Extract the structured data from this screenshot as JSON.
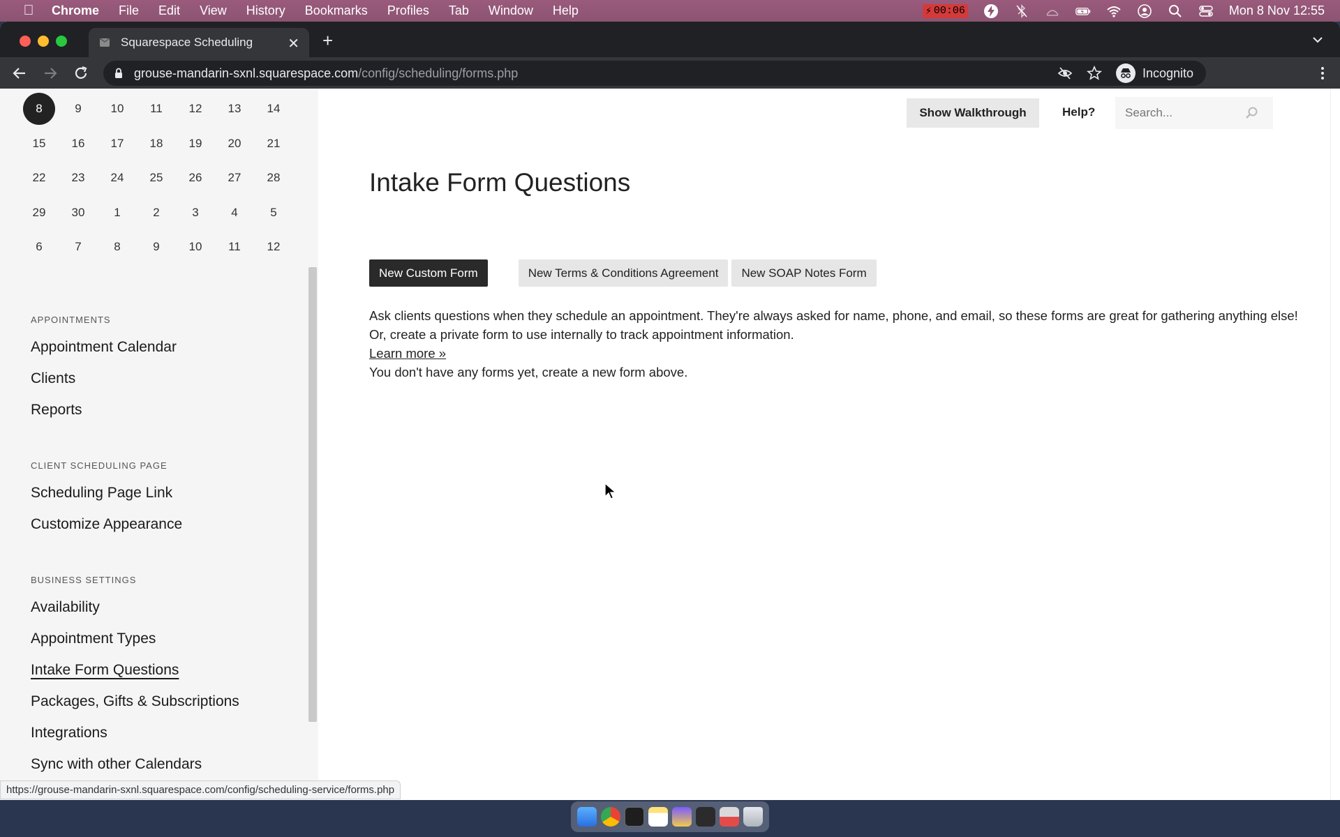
{
  "menubar": {
    "app": "Chrome",
    "items": [
      "File",
      "Edit",
      "View",
      "History",
      "Bookmarks",
      "Profiles",
      "Tab",
      "Window",
      "Help"
    ],
    "recording_time": "00:06",
    "clock": "Mon 8 Nov  12:55"
  },
  "browser": {
    "tab_title": "Squarespace Scheduling",
    "url_host": "grouse-mandarin-sxnl.squarespace.com",
    "url_path": "/config/scheduling/forms.php",
    "profile_label": "Incognito",
    "status_url": "https://grouse-mandarin-sxnl.squarespace.com/config/scheduling-service/forms.php"
  },
  "calendar": {
    "weeks": [
      [
        "8",
        "9",
        "10",
        "11",
        "12",
        "13",
        "14"
      ],
      [
        "15",
        "16",
        "17",
        "18",
        "19",
        "20",
        "21"
      ],
      [
        "22",
        "23",
        "24",
        "25",
        "26",
        "27",
        "28"
      ],
      [
        "29",
        "30",
        "1",
        "2",
        "3",
        "4",
        "5"
      ],
      [
        "6",
        "7",
        "8",
        "9",
        "10",
        "11",
        "12"
      ]
    ]
  },
  "sidebar": {
    "appointments_heading": "APPOINTMENTS",
    "appointments": [
      "Appointment Calendar",
      "Clients",
      "Reports"
    ],
    "client_page_heading": "CLIENT SCHEDULING PAGE",
    "client_page": [
      "Scheduling Page Link",
      "Customize Appearance"
    ],
    "business_heading": "BUSINESS SETTINGS",
    "business": [
      "Availability",
      "Appointment Types",
      "Intake Form Questions",
      "Packages, Gifts & Subscriptions",
      "Integrations",
      "Sync with other Calendars"
    ]
  },
  "main": {
    "walkthrough_label": "Show Walkthrough",
    "help_label": "Help?",
    "search_placeholder": "Search...",
    "title": "Intake Form Questions",
    "new_custom_form": "New Custom Form",
    "new_terms": "New Terms & Conditions Agreement",
    "new_soap": "New SOAP Notes Form",
    "description": "Ask clients questions when they schedule an appointment. They're always asked for name, phone, and email, so these forms are great for gathering anything else! Or, create a private form to use internally to track appointment information.",
    "learn_more": "Learn more »",
    "empty_message": "You don't have any forms yet, create a new form above."
  }
}
